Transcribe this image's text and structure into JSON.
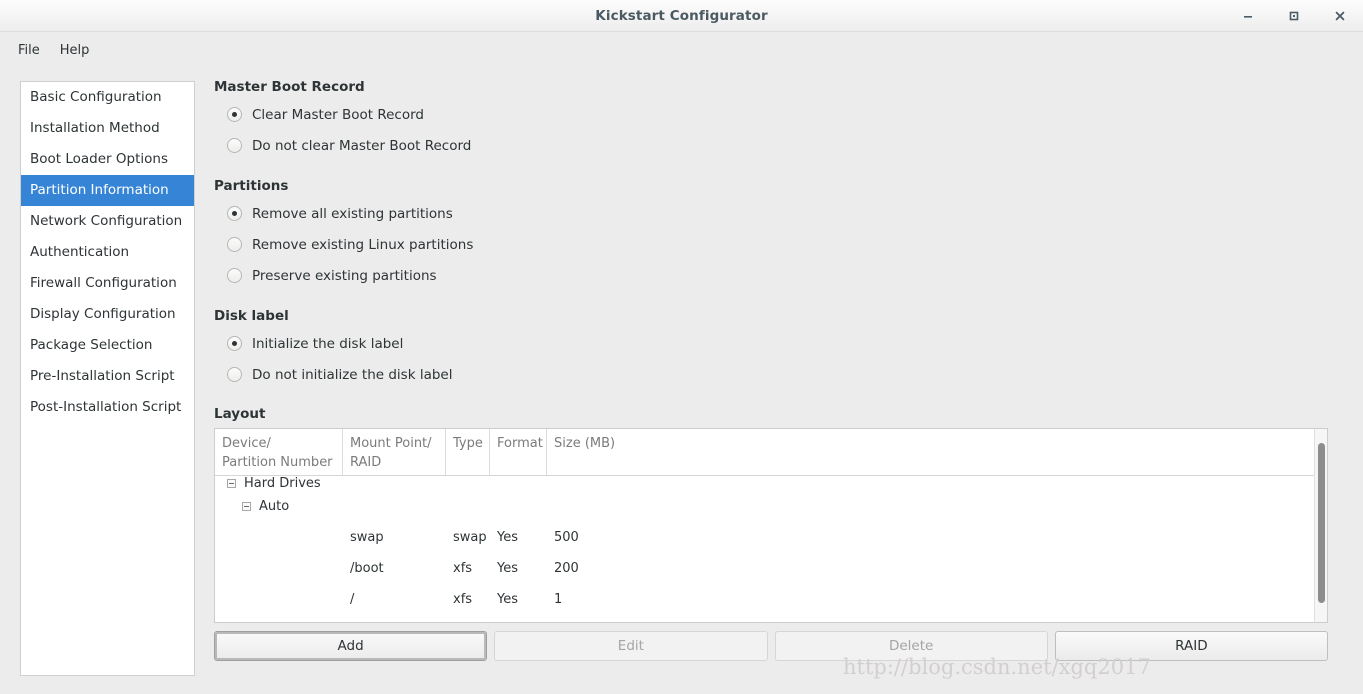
{
  "window": {
    "title": "Kickstart Configurator",
    "controls": [
      {
        "name": "minimize",
        "glyph": "minimize-icon"
      },
      {
        "name": "maximize",
        "glyph": "maximize-icon"
      },
      {
        "name": "close",
        "glyph": "close-icon"
      }
    ]
  },
  "menubar": {
    "items": [
      {
        "label": "File"
      },
      {
        "label": "Help"
      }
    ]
  },
  "sidebar": {
    "items": [
      {
        "label": "Basic Configuration",
        "selected": false
      },
      {
        "label": "Installation Method",
        "selected": false
      },
      {
        "label": "Boot Loader Options",
        "selected": false
      },
      {
        "label": "Partition Information",
        "selected": true
      },
      {
        "label": "Network Configuration",
        "selected": false
      },
      {
        "label": "Authentication",
        "selected": false
      },
      {
        "label": "Firewall Configuration",
        "selected": false
      },
      {
        "label": "Display Configuration",
        "selected": false
      },
      {
        "label": "Package Selection",
        "selected": false
      },
      {
        "label": "Pre-Installation Script",
        "selected": false
      },
      {
        "label": "Post-Installation Script",
        "selected": false
      }
    ]
  },
  "main": {
    "groups": [
      {
        "title": "Master Boot Record",
        "options": [
          {
            "label": "Clear Master Boot Record",
            "selected": true
          },
          {
            "label": "Do not clear Master Boot Record",
            "selected": false
          }
        ]
      },
      {
        "title": "Partitions",
        "options": [
          {
            "label": "Remove all existing partitions",
            "selected": true
          },
          {
            "label": "Remove existing Linux partitions",
            "selected": false
          },
          {
            "label": "Preserve existing partitions",
            "selected": false
          }
        ]
      },
      {
        "title": "Disk label",
        "options": [
          {
            "label": "Initialize the disk label",
            "selected": true
          },
          {
            "label": "Do not initialize the disk label",
            "selected": false
          }
        ]
      }
    ],
    "layout": {
      "title": "Layout",
      "columns": [
        "Device/\nPartition Number",
        "Mount Point/\nRAID",
        "Type",
        "Format",
        "Size (MB)"
      ],
      "tree": [
        {
          "kind": "group",
          "label": "Hard Drives",
          "expanded": true,
          "indent": 0
        },
        {
          "kind": "group",
          "label": "Auto",
          "expanded": true,
          "indent": 1
        },
        {
          "kind": "row",
          "device": "",
          "mount": "swap",
          "type": "swap",
          "format": "Yes",
          "size": "500"
        },
        {
          "kind": "row",
          "device": "",
          "mount": "/boot",
          "type": "xfs",
          "format": "Yes",
          "size": "200"
        },
        {
          "kind": "row",
          "device": "",
          "mount": "/",
          "type": "xfs",
          "format": "Yes",
          "size": "1"
        }
      ]
    },
    "buttons": [
      {
        "label": "Add",
        "state": "focused"
      },
      {
        "label": "Edit",
        "state": "disabled"
      },
      {
        "label": "Delete",
        "state": "disabled"
      },
      {
        "label": "RAID",
        "state": "normal"
      }
    ]
  },
  "watermark": {
    "text": "http://blog.csdn.net/xgq2017"
  },
  "colors": {
    "selection": "#3584d6",
    "window_bg": "#ececec",
    "panel_bg": "#ffffff",
    "header_text": "#7b7b7b"
  }
}
